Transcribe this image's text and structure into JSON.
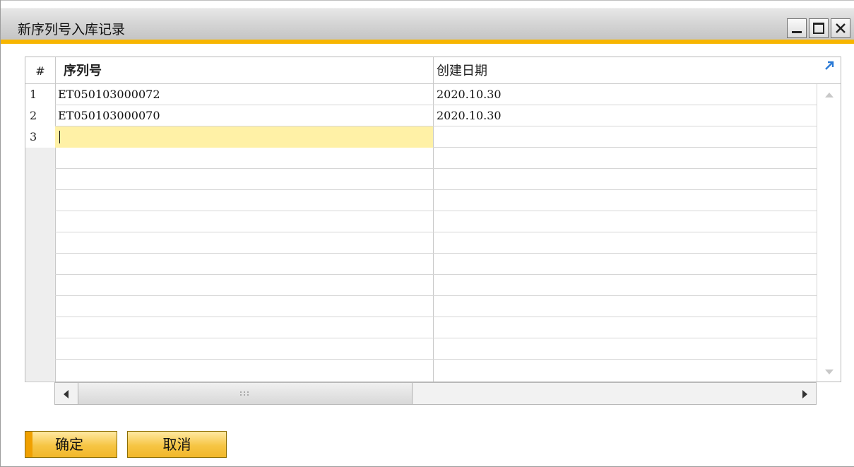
{
  "window": {
    "title": "新序列号入库记录"
  },
  "grid": {
    "columns": {
      "num": "#",
      "serial": "序列号",
      "date": "创建日期"
    },
    "rows": [
      {
        "num": "1",
        "serial": "ET050103000072",
        "date": "2020.10.30"
      },
      {
        "num": "2",
        "serial": "ET050103000070",
        "date": "2020.10.30"
      },
      {
        "num": "3",
        "serial": "",
        "date": ""
      }
    ]
  },
  "buttons": {
    "ok": "确定",
    "cancel": "取消"
  },
  "icons": {
    "minimize": "minimize-icon",
    "maximize": "maximize-icon",
    "close": "close-icon",
    "expand": "expand-arrow-icon"
  },
  "colors": {
    "accent": "#f7b500",
    "active_cell": "#fff1a6",
    "button": "#f6c544"
  }
}
